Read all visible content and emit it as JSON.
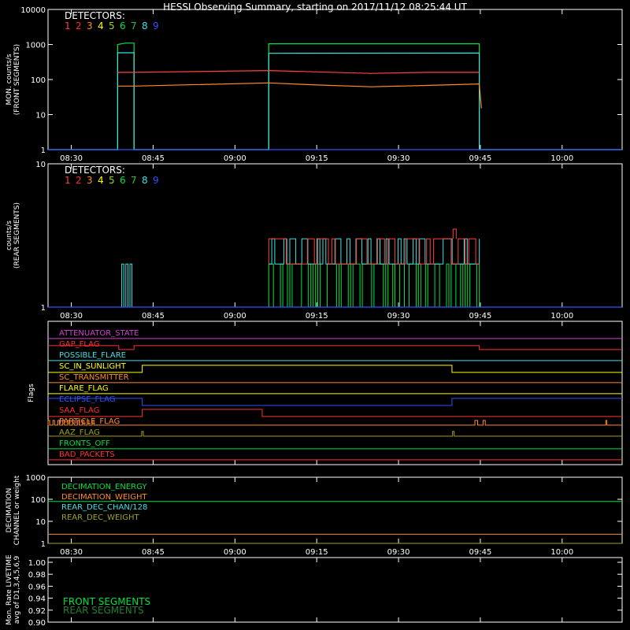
{
  "title": "HESSI Observing Summary, starting on 2017/11/12 08:25:44 UT",
  "colors": {
    "white": "#ffffff",
    "det1": "#ff4040",
    "det2": "#ff2a2a",
    "det3": "#ff8a2a",
    "det4": "#ffff00",
    "det5": "#a0d020",
    "det6": "#00e040",
    "det7": "#30c040",
    "det8": "#40e0e0",
    "det9": "#3050ff"
  },
  "time_axis": {
    "ticks": [
      "08:30",
      "08:45",
      "09:00",
      "09:15",
      "09:30",
      "09:45",
      "10:00"
    ],
    "tick_minutes": [
      30,
      45,
      60,
      75,
      90,
      105,
      120
    ],
    "x_range_minutes": [
      25.73,
      131.0
    ]
  },
  "chart_data": [
    {
      "type": "line",
      "name": "front",
      "ylabel": "MON. counts/s\n(FRONT SEGMENTS)",
      "yscale": "log",
      "ylim": [
        1,
        10000
      ],
      "ytick_labels": [
        "1",
        "10",
        "100",
        "1000",
        "10000"
      ],
      "ytick_values": [
        1,
        10,
        100,
        1000,
        10000
      ],
      "legend_title": "DETECTORS:",
      "legend_numbers": [
        "1",
        "2",
        "3",
        "4",
        "5",
        "6",
        "7",
        "8",
        "9"
      ],
      "legend_colors": [
        "#ff4040",
        "#ff2a2a",
        "#ff8a2a",
        "#ffff00",
        "#a0d020",
        "#00e040",
        "#30c040",
        "#40e0e0",
        "#3050ff"
      ],
      "series": [
        {
          "color": "#00e040",
          "values": [
            [
              25.73,
              1
            ],
            [
              38.5,
              1
            ],
            [
              38.5,
              1000
            ],
            [
              40,
              1100
            ],
            [
              41.5,
              1100
            ],
            [
              41.5,
              1
            ],
            [
              66.2,
              1
            ],
            [
              66.2,
              1050
            ],
            [
              104.8,
              1050
            ],
            [
              104.8,
              1
            ],
            [
              131,
              1
            ]
          ]
        },
        {
          "color": "#40e0e0",
          "values": [
            [
              25.73,
              1
            ],
            [
              38.5,
              1
            ],
            [
              38.5,
              580
            ],
            [
              41.5,
              580
            ],
            [
              41.5,
              1
            ],
            [
              66.2,
              1
            ],
            [
              66.2,
              560
            ],
            [
              104.8,
              570
            ],
            [
              104.8,
              1
            ],
            [
              131,
              1
            ]
          ]
        },
        {
          "color": "#ff4040",
          "values": [
            [
              38.5,
              160
            ],
            [
              41.5,
              160
            ],
            [
              66.2,
              180
            ],
            [
              75,
              165
            ],
            [
              85,
              150
            ],
            [
              95,
              160
            ],
            [
              104.8,
              160
            ]
          ]
        },
        {
          "color": "#ff8a2a",
          "values": [
            [
              38.5,
              65
            ],
            [
              41.5,
              65
            ],
            [
              66.2,
              80
            ],
            [
              75,
              70
            ],
            [
              85,
              62
            ],
            [
              95,
              68
            ],
            [
              104.8,
              75
            ],
            [
              105.2,
              15
            ]
          ]
        },
        {
          "color": "#3050ff",
          "values": [
            [
              25.73,
              1
            ],
            [
              131,
              1
            ]
          ]
        }
      ]
    },
    {
      "type": "line",
      "name": "rear",
      "ylabel": "counts/s\n(REAR SEGMENTS)",
      "yscale": "log",
      "ylim": [
        1,
        10
      ],
      "ytick_labels": [
        "1",
        "10"
      ],
      "ytick_values": [
        1,
        10
      ],
      "legend_title": "DETECTORS:",
      "legend_numbers": [
        "1",
        "2",
        "3",
        "4",
        "5",
        "6",
        "7",
        "8",
        "9"
      ],
      "legend_colors": [
        "#ff4040",
        "#ff2a2a",
        "#ff8a2a",
        "#ffff00",
        "#a0d020",
        "#00e040",
        "#30c040",
        "#40e0e0",
        "#3050ff"
      ],
      "series": [
        {
          "color": "#40e0e0",
          "values": [
            [
              38.5,
              2
            ],
            [
              41.5,
              2
            ],
            [
              66.2,
              3
            ],
            [
              104.8,
              3
            ]
          ]
        },
        {
          "color": "#ff4040",
          "values": [
            [
              66.2,
              3
            ],
            [
              100,
              3.5
            ],
            [
              104.8,
              3
            ]
          ]
        },
        {
          "color": "#00e040",
          "values": [
            [
              66.2,
              2
            ],
            [
              104.8,
              2
            ]
          ]
        },
        {
          "color": "#3050ff",
          "values": [
            [
              25.73,
              1
            ],
            [
              131,
              1
            ]
          ]
        }
      ]
    }
  ],
  "flags": {
    "ylabel": "Flags",
    "items": [
      {
        "label": "ATTENUATOR_STATE",
        "color": "#d040d0"
      },
      {
        "label": "GAP_FLAG",
        "color": "#ff3030"
      },
      {
        "label": "POSSIBLE_FLARE",
        "color": "#40e0e0"
      },
      {
        "label": "SC_IN_SUNLIGHT",
        "color": "#ffff00"
      },
      {
        "label": "SC_TRANSMITTER",
        "color": "#ff8a2a"
      },
      {
        "label": "FLARE_FLAG",
        "color": "#ffff00"
      },
      {
        "label": "ECLIPSE_FLAG",
        "color": "#3050ff"
      },
      {
        "label": "SAA_FLAG",
        "color": "#ff3030"
      },
      {
        "label": "PARTICLE_FLAG",
        "color": "#ff8a2a"
      },
      {
        "label": "AAZ_FLAG",
        "color": "#a0a020"
      },
      {
        "label": "FRONTS_OFF",
        "color": "#00e040"
      },
      {
        "label": "BAD_PACKETS",
        "color": "#ff3030"
      }
    ]
  },
  "decimation": {
    "ylabel": "DECIMATION\nCHANNEL or weight",
    "ytick_labels": [
      "1",
      "10",
      "100",
      "1000"
    ],
    "ytick_values": [
      1,
      10,
      100,
      1000
    ],
    "items": [
      {
        "label": "DECIMATION_ENERGY",
        "color": "#00e040"
      },
      {
        "label": "DECIMATION_WEIGHT",
        "color": "#ff8a2a"
      },
      {
        "label": "REAR_DEC_CHAN/128",
        "color": "#40e0e0"
      },
      {
        "label": "REAR_DEC_WEIGHT",
        "color": "#a0a020"
      }
    ]
  },
  "livetime": {
    "ylabel": "Mon. Rate LIVETIME\navg of D1,3,4,5,6,9",
    "ytick_labels": [
      "0.90",
      "0.92",
      "0.94",
      "0.96",
      "0.98",
      "1.00"
    ],
    "ytick_values": [
      0.9,
      0.92,
      0.94,
      0.96,
      0.98,
      1.0
    ],
    "legend": [
      {
        "label": "FRONT SEGMENTS",
        "color": "#00e040"
      },
      {
        "label": "REAR SEGMENTS",
        "color": "#208030"
      }
    ]
  }
}
